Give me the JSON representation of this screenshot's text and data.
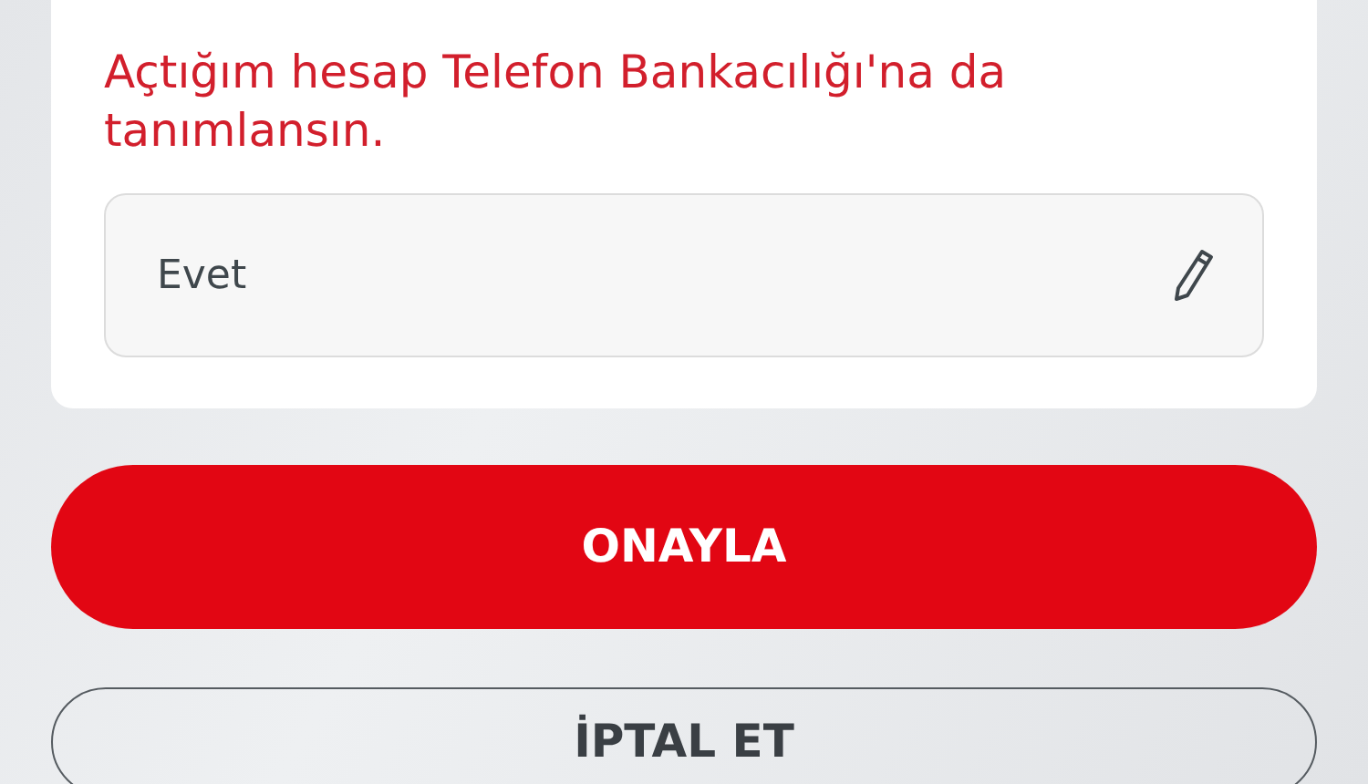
{
  "question": {
    "text": "Açtığım hesap Telefon Bankacılığı'na da tanımlansın."
  },
  "answer": {
    "value": "Evet"
  },
  "buttons": [
    {
      "label": "ONAYLA",
      "kind": "primary"
    },
    {
      "label": "İPTAL ET",
      "kind": "outline"
    }
  ]
}
